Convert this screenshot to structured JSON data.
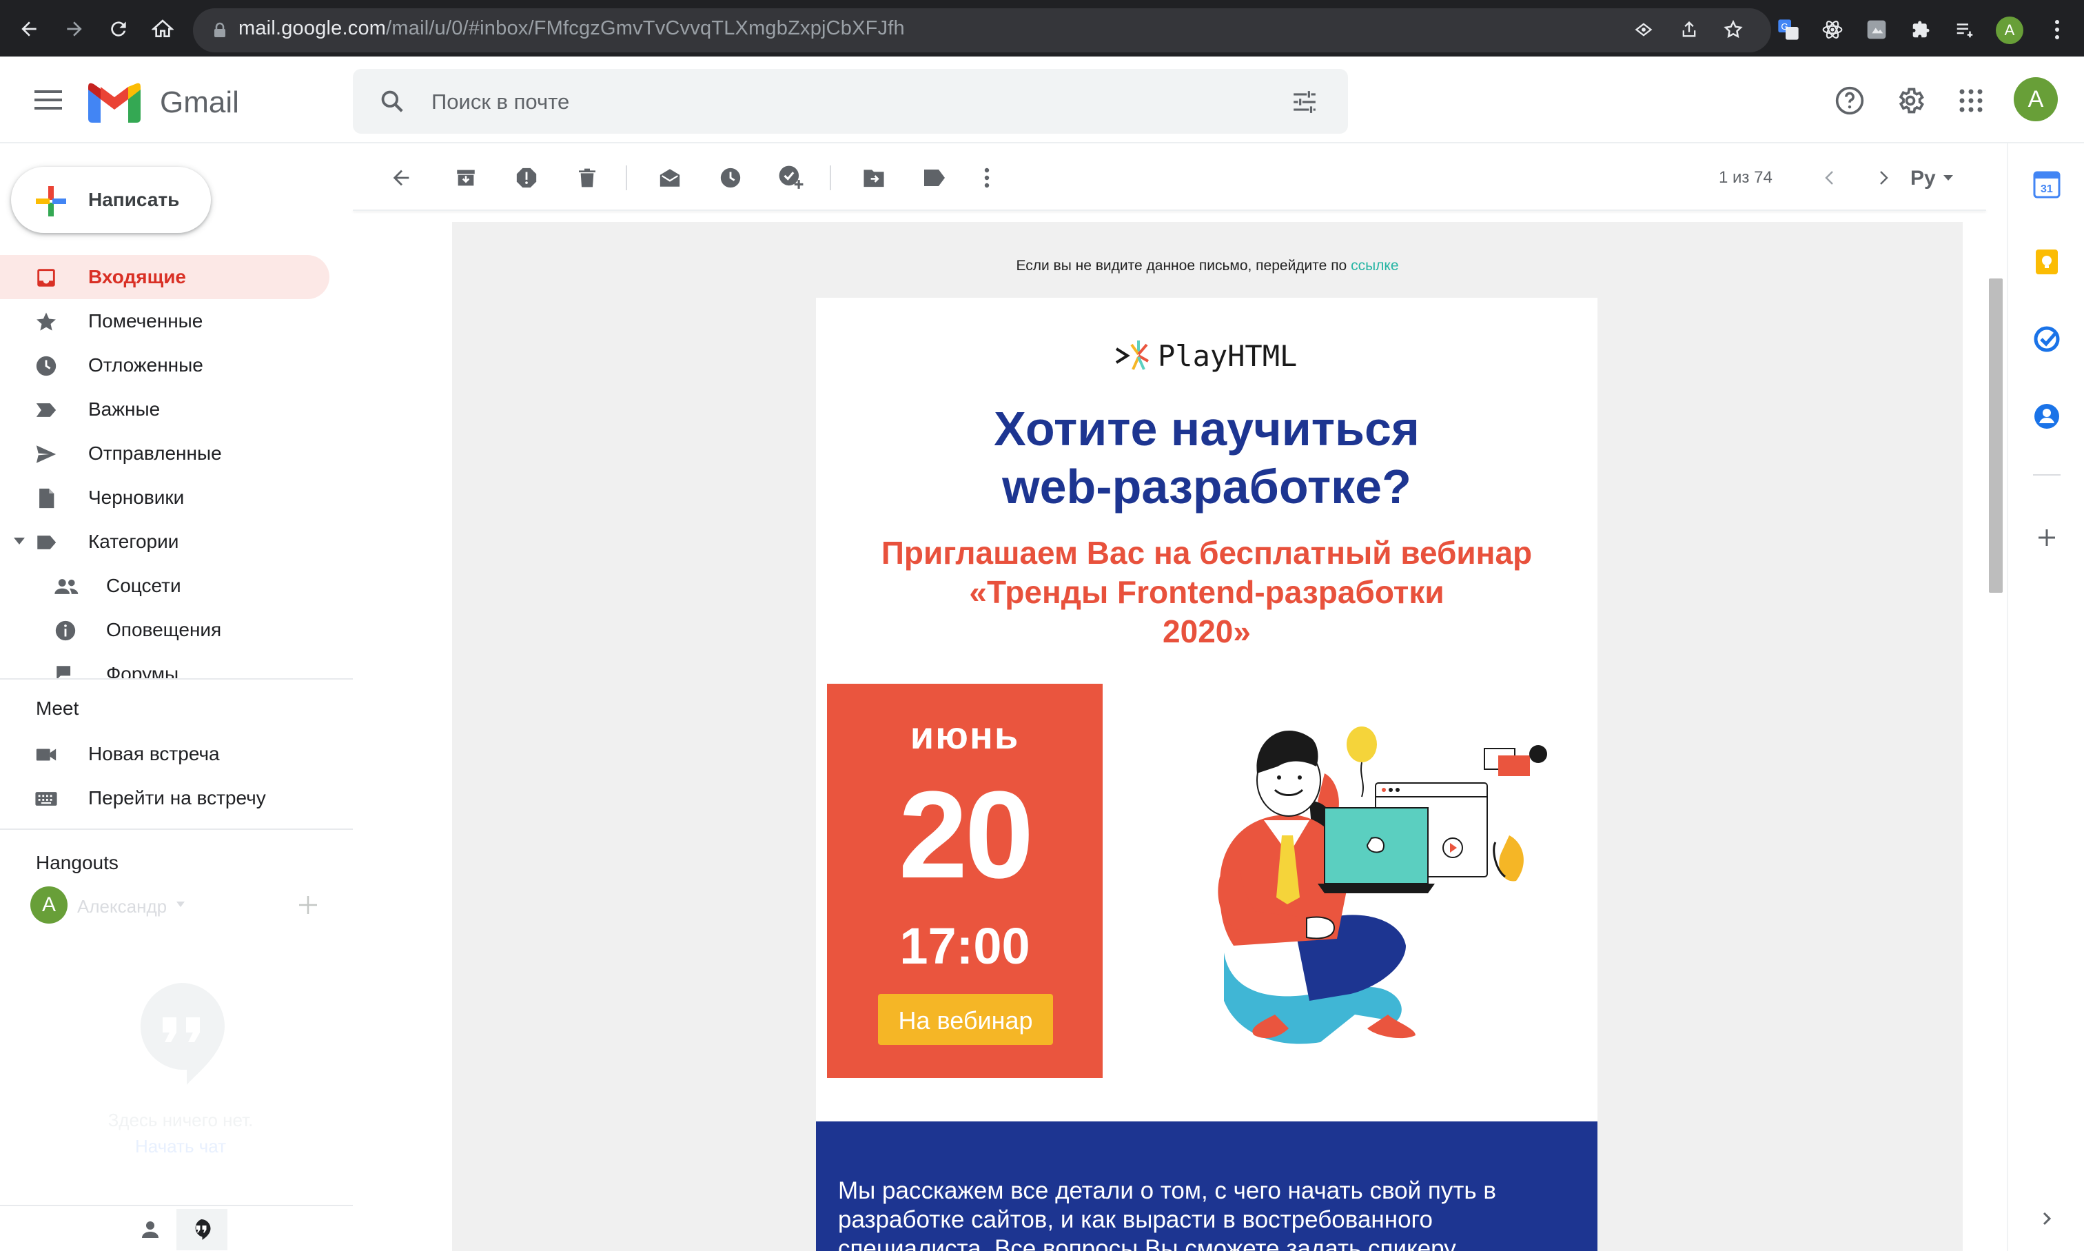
{
  "browser": {
    "url_host": "mail.google.com",
    "url_path": "/mail/u/0/#inbox/FMfcgzGmvTvCvvqTLXmgbZxpjCbXFJfh",
    "profile_initial": "A"
  },
  "header": {
    "app_name": "Gmail",
    "search_placeholder": "Поиск в почте",
    "account_initial": "A"
  },
  "sidebar": {
    "compose_label": "Написать",
    "items": [
      {
        "label": "Входящие",
        "icon": "inbox-icon",
        "active": true
      },
      {
        "label": "Помеченные",
        "icon": "star-icon"
      },
      {
        "label": "Отложенные",
        "icon": "clock-icon"
      },
      {
        "label": "Важные",
        "icon": "important-icon"
      },
      {
        "label": "Отправленные",
        "icon": "send-icon"
      },
      {
        "label": "Черновики",
        "icon": "draft-icon"
      },
      {
        "label": "Категории",
        "icon": "label-icon"
      }
    ],
    "categories": [
      {
        "label": "Соцсети",
        "icon": "people-icon"
      },
      {
        "label": "Оповещения",
        "icon": "info-icon"
      },
      {
        "label": "Форумы",
        "icon": "forum-icon"
      }
    ],
    "meet": {
      "title": "Meet",
      "new_meeting": "Новая встреча",
      "join_meeting": "Перейти на встречу"
    },
    "hangouts": {
      "title": "Hangouts",
      "user_initial": "A",
      "user_name": "Александр",
      "empty_line1": "Здесь ничего нет.",
      "empty_line2": "Начать чат"
    }
  },
  "toolbar": {
    "pager": "1 из 74",
    "input_tool": "Ру"
  },
  "email": {
    "notice_text": "Если вы не видите данное письмо, перейдите по ",
    "notice_link": "ссылке",
    "brand": "PlayHTML",
    "headline_line1": "Хотите научиться",
    "headline_line2": "web-разработке?",
    "sub_line1": "Приглашаем Вас на бесплатный вебинар",
    "sub_line2": "«Тренды Frontend-разработки",
    "sub_line3": "2020»",
    "month": "июнь",
    "day": "20",
    "time": "17:00",
    "cta": "На вебинар",
    "body_text": "Мы расскажем все детали о том, с чего начать свой путь в разработке сайтов, и как вырасти в востребованного специалиста. Все вопросы Вы сможете задать спикеру",
    "colors": {
      "navy": "#1d3591",
      "coral": "#ea553e",
      "yellow": "#f5b626",
      "teal": "#5bcfc0"
    }
  }
}
